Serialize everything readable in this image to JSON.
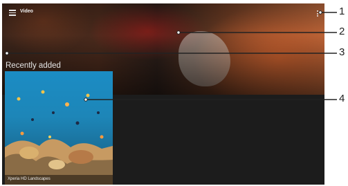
{
  "app_bar": {
    "title": "Video",
    "menu_icon": "hamburger-menu-icon",
    "overflow_icon": "more-vertical-icon"
  },
  "section": {
    "title": "Recently added"
  },
  "videos": [
    {
      "title": "Xperia HD Landscapes"
    }
  ],
  "callouts": [
    "1",
    "2",
    "3",
    "4"
  ],
  "colors": {
    "screen_bg": "#1c1c1c",
    "hero_accent": "#b4643a",
    "thumbnail_water": "#1b8cc4",
    "callout_line": "#222222"
  }
}
